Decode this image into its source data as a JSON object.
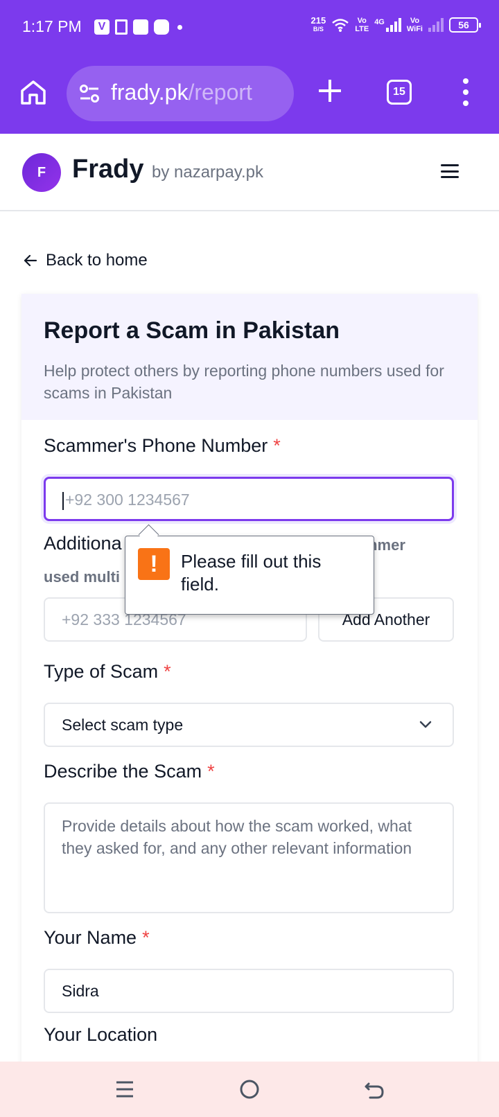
{
  "status_bar": {
    "time": "1:17 PM",
    "net_speed_value": "215",
    "net_speed_unit": "B/S",
    "volte1_top": "Vo",
    "volte1_bottom": "LTE",
    "signal_label": "4G",
    "vowifi_top": "Vo",
    "vowifi_bottom": "WiFi",
    "battery": "56"
  },
  "browser": {
    "url_host": "frady.pk",
    "url_path": "/report",
    "tab_count": "15"
  },
  "site": {
    "logo_letter": "F",
    "brand": "Frady",
    "byline": "by nazarpay.pk"
  },
  "back_link": "Back to home",
  "form": {
    "title": "Report a Scam in Pakistan",
    "subtitle": "Help protect others by reporting phone numbers used for scams in Pakistan",
    "phone_label": "Scammer's Phone Number",
    "phone_placeholder": "+92 300 1234567",
    "additional_label_visible": "Additiona",
    "additional_hint_right": "mmer",
    "additional_hint_left": "used multi",
    "additional_placeholder": "+92 333 1234567",
    "add_another": "Add Another",
    "type_label": "Type of Scam",
    "type_value": "Select scam type",
    "describe_label": "Describe the Scam",
    "describe_placeholder": "Provide details about how the scam worked, what they asked for, and any other relevant information",
    "name_label": "Your Name",
    "name_value": "Sidra",
    "location_label": "Your Location",
    "required_mark": "*"
  },
  "tooltip": {
    "icon": "!",
    "text": "Please fill out this field."
  },
  "colors": {
    "brand_purple": "#7c3aed",
    "required_red": "#ef4444",
    "warning_orange": "#f97316"
  }
}
